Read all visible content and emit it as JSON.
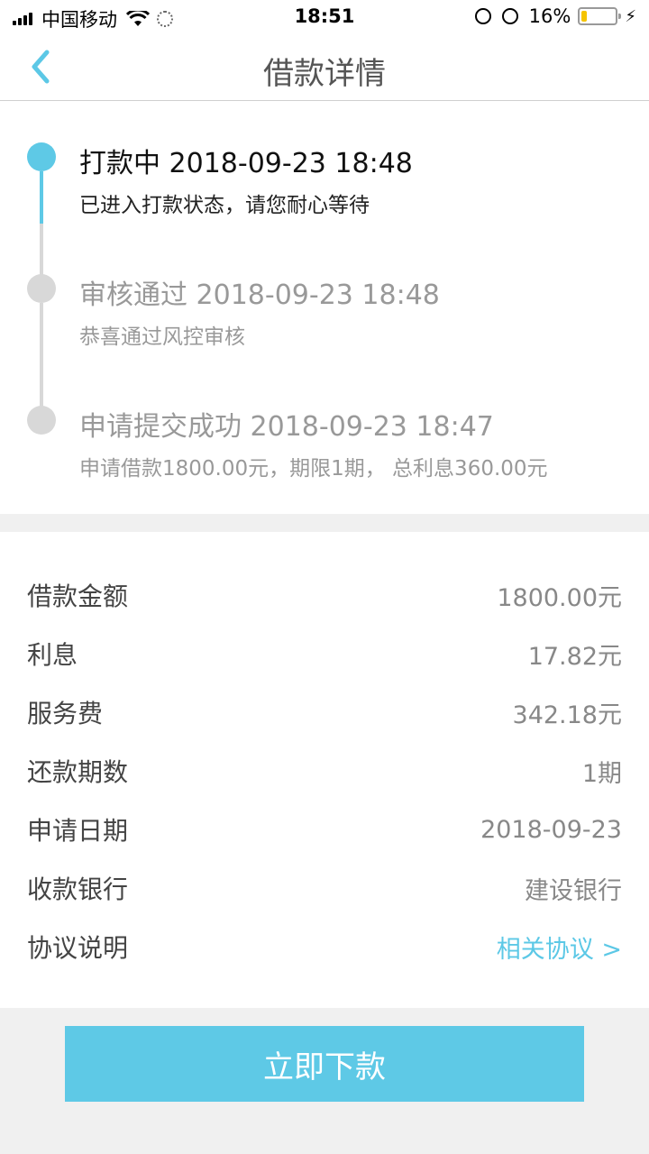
{
  "status_bar": {
    "carrier": "中国移动",
    "time": "18:51",
    "battery_percent": "16%",
    "battery_level": 0.16
  },
  "nav": {
    "title": "借款详情"
  },
  "timeline": [
    {
      "title": "打款中 2018-09-23 18:48",
      "desc": "已进入打款状态，请您耐心等待",
      "active": true
    },
    {
      "title": "审核通过 2018-09-23 18:48",
      "desc": "恭喜通过风控审核",
      "active": false
    },
    {
      "title": "申请提交成功 2018-09-23 18:47",
      "desc": "申请借款1800.00元，期限1期， 总利息360.00元",
      "active": false
    }
  ],
  "details": [
    {
      "label": "借款金额",
      "value": "1800.00元"
    },
    {
      "label": "利息",
      "value": "17.82元"
    },
    {
      "label": "服务费",
      "value": "342.18元"
    },
    {
      "label": "还款期数",
      "value": "1期"
    },
    {
      "label": "申请日期",
      "value": "2018-09-23"
    },
    {
      "label": "收款银行",
      "value": "建设银行"
    },
    {
      "label": "协议说明",
      "value": "相关协议 >"
    }
  ],
  "submit_label": "立即下款",
  "colors": {
    "accent": "#5ec9e6",
    "inactive_dot": "#d8d8d8",
    "inactive_text": "#999999"
  }
}
